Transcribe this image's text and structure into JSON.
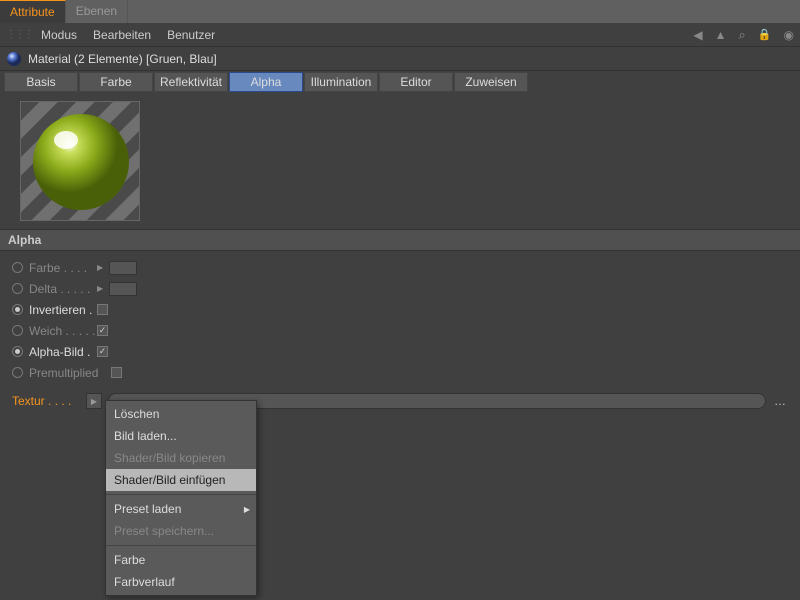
{
  "top_tabs": {
    "attribute": "Attribute",
    "ebenen": "Ebenen"
  },
  "menu": {
    "modus": "Modus",
    "bearbeiten": "Bearbeiten",
    "benutzer": "Benutzer"
  },
  "material_row": "Material (2 Elemente) [Gruen, Blau]",
  "channels": {
    "basis": "Basis",
    "farbe": "Farbe",
    "reflekt": "Reflektivität",
    "alpha": "Alpha",
    "illum": "Illumination",
    "editor": "Editor",
    "zuweisen": "Zuweisen"
  },
  "section": "Alpha",
  "props": {
    "farbe": "Farbe",
    "delta": "Delta",
    "invertieren": "Invertieren",
    "weich": "Weich",
    "alpha_bild": "Alpha-Bild",
    "premultiplied": "Premultiplied"
  },
  "textur_label": "Textur",
  "context": {
    "loeschen": "Löschen",
    "bild_laden": "Bild laden...",
    "kopieren": "Shader/Bild kopieren",
    "einfuegen": "Shader/Bild einfügen",
    "preset_laden": "Preset laden",
    "preset_speichern": "Preset speichern...",
    "farbe": "Farbe",
    "farbverlauf": "Farbverlauf"
  }
}
